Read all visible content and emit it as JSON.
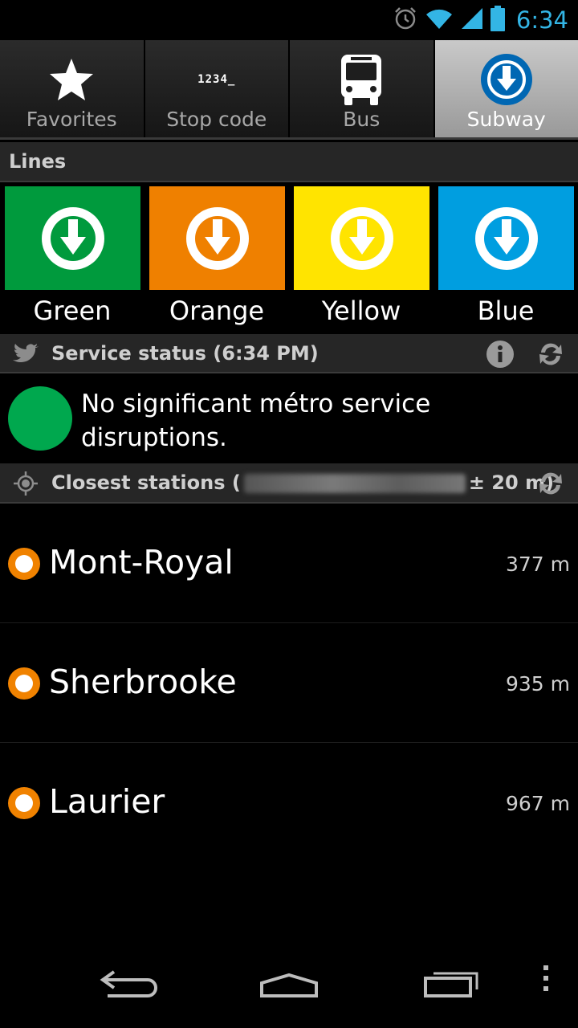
{
  "status_bar": {
    "time": "6:34"
  },
  "tabs": [
    {
      "label": "Favorites",
      "icon": "star-icon",
      "active": false
    },
    {
      "label": "Stop code",
      "icon": "stop-code-icon",
      "icon_text": "1234_",
      "active": false
    },
    {
      "label": "Bus",
      "icon": "bus-icon",
      "active": false
    },
    {
      "label": "Subway",
      "icon": "metro-icon",
      "active": true
    }
  ],
  "lines": {
    "header": "Lines",
    "items": [
      {
        "label": "Green",
        "color": "#009a3d"
      },
      {
        "label": "Orange",
        "color": "#ef8000"
      },
      {
        "label": "Yellow",
        "color": "#ffe400"
      },
      {
        "label": "Blue",
        "color": "#009ee0"
      }
    ]
  },
  "service_status": {
    "header": "Service status (6:34 PM)",
    "status_color": "#00a84e",
    "message": "No significant métro service disruptions."
  },
  "closest": {
    "header_prefix": "Closest stations (",
    "header_suffix": "± 20 m)",
    "stations": [
      {
        "name": "Mont-Royal",
        "distance": "377 m",
        "line_color": "#f08200"
      },
      {
        "name": "Sherbrooke",
        "distance": "935 m",
        "line_color": "#f08200"
      },
      {
        "name": "Laurier",
        "distance": "967 m",
        "line_color": "#f08200"
      }
    ]
  }
}
